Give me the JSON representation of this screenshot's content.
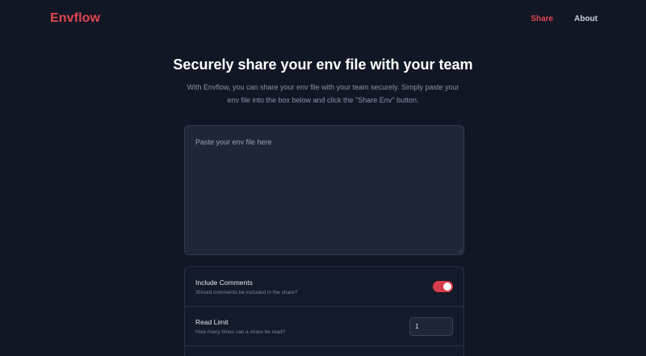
{
  "header": {
    "brand": "Envflow",
    "nav": [
      {
        "label": "Share",
        "active": true
      },
      {
        "label": "About",
        "active": false
      }
    ]
  },
  "hero": {
    "title": "Securely share your env file with your team",
    "description": "With Envflow, you can share your env file with your team securely. Simply paste your env file into the box below and click the \"Share Env\" button."
  },
  "editor": {
    "placeholder": "Paste your env file here",
    "value": ""
  },
  "options": [
    {
      "title": "Include Comments",
      "subtitle": "Should comments be included in the share?",
      "control": "toggle",
      "enabled": true
    },
    {
      "title": "Read Limit",
      "subtitle": "How many times can a share be read?",
      "control": "number",
      "value": "1"
    }
  ],
  "colors": {
    "background": "#121726",
    "accent": "#e0464f",
    "panel": "#1e2637"
  }
}
